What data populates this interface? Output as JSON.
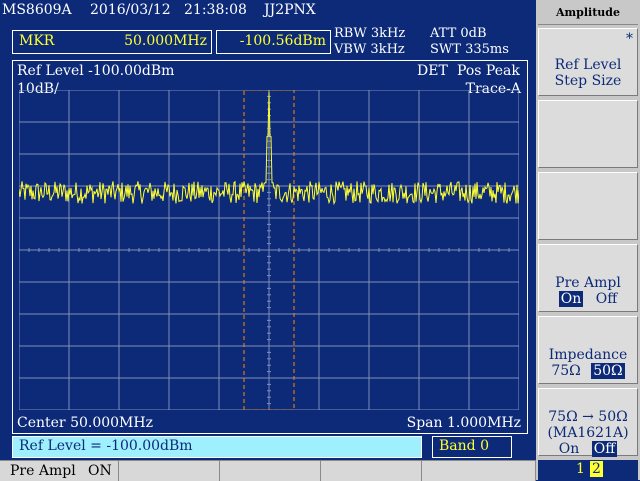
{
  "header": {
    "model": "MS8609A",
    "date": "2016/03/12",
    "time": "21:38:08",
    "callsign": "JJ2PNX"
  },
  "marker": {
    "label": "MKR",
    "frequency": "50.000MHz",
    "level": "-100.56dBm"
  },
  "params": {
    "rbw": "RBW 3kHz",
    "vbw": "VBW 3kHz",
    "att": "ATT 0dB",
    "swt": "SWT 335ms"
  },
  "display": {
    "ref_level": "Ref Level -100.00dBm",
    "det": "DET",
    "det_mode": "Pos Peak",
    "scale": "10dB/",
    "trace": "Trace-A",
    "center": "Center 50.000MHz",
    "span": "Span 1.000MHz"
  },
  "status": {
    "entry": "Ref Level = -100.00dBm",
    "band": "Band 0"
  },
  "footer": {
    "preamp": "Pre Ampl",
    "preamp_state": "ON"
  },
  "softkeys": {
    "title": "Amplitude",
    "key1_mark": "*",
    "key1_line1": "Ref Level",
    "key1_line2": "Step Size",
    "key4_line1": "Pre Ampl",
    "key4_on": "On",
    "key4_off": "Off",
    "key5_line1": "Impedance",
    "key5_a": "75Ω",
    "key5_b": "50Ω",
    "key6_line1": "75Ω → 50Ω",
    "key6_line2": "(MA1621A)",
    "key6_on": "On",
    "key6_off": "Off",
    "page_1": "1",
    "page_2": "2"
  },
  "colors": {
    "background": "#0c2a78",
    "trace": "#ffff33",
    "marker_window": "#ff8800",
    "entry_box": "#9ff0ff"
  },
  "chart_data": {
    "type": "line",
    "x_range_mhz": [
      49.5,
      50.5
    ],
    "y_range_dbm": [
      -200,
      -100
    ],
    "noise_floor_dbm": -132,
    "peak": {
      "x": 50.0,
      "y": -100.56
    },
    "marker_window_mhz": [
      49.95,
      50.05
    ]
  }
}
